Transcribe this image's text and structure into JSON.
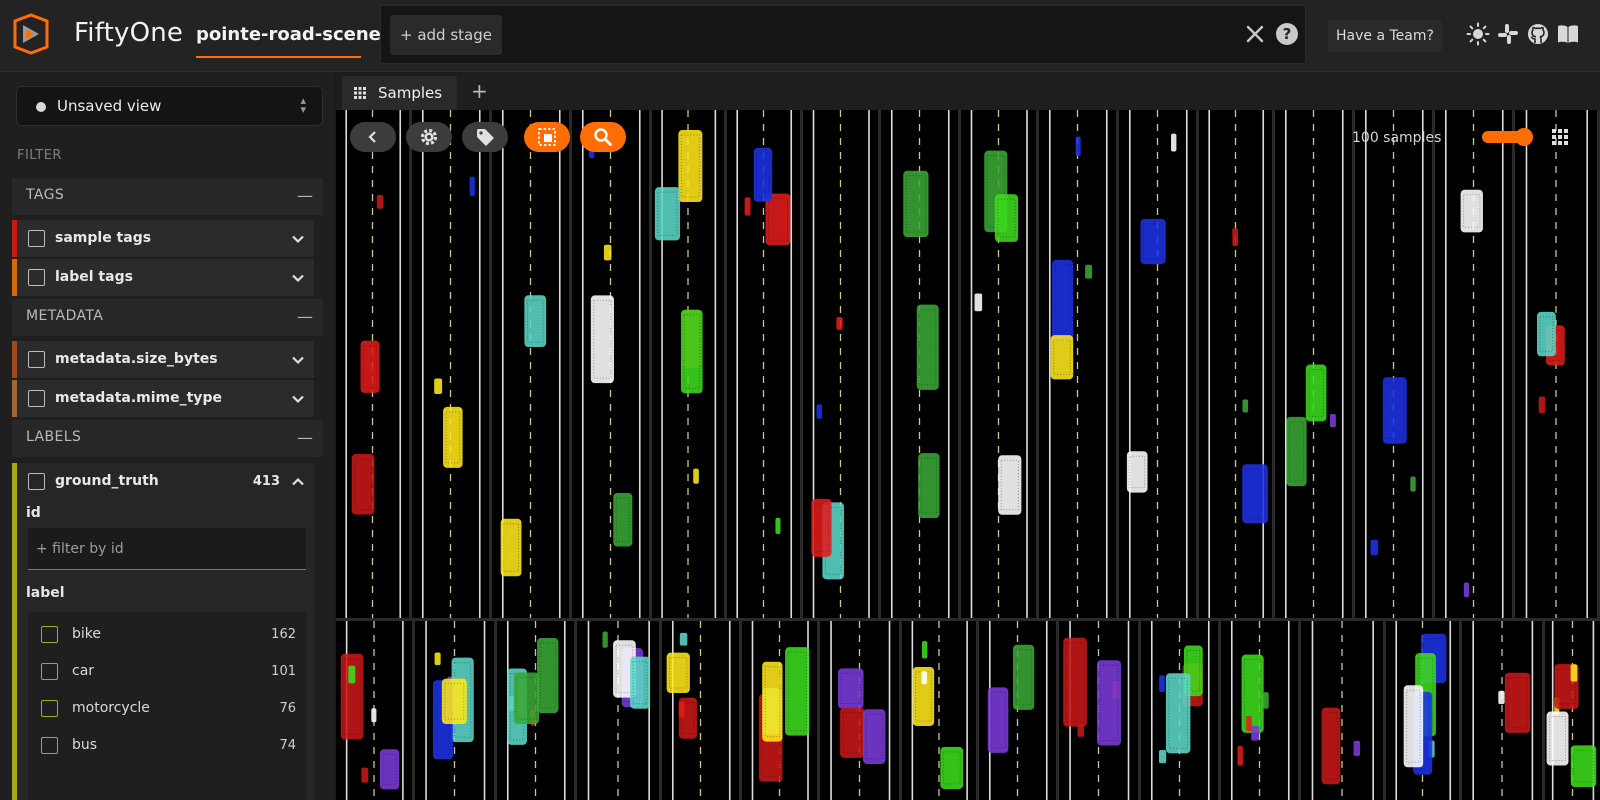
{
  "header": {
    "app_title": "FiftyOne",
    "dataset_name": "pointe-road-scenes",
    "add_stage_label": "+ add stage",
    "team_button_label": "Have a Team?",
    "icons": [
      "brightness-icon",
      "slack-icon",
      "github-icon",
      "book-icon"
    ]
  },
  "sidebar": {
    "view_select_label": "Unsaved view",
    "filter_title": "FILTER",
    "groups": {
      "tags": "TAGS",
      "metadata": "METADATA",
      "labels": "LABELS"
    },
    "fields": {
      "sample_tags": "sample tags",
      "label_tags": "label tags",
      "size_bytes": "metadata.size_bytes",
      "mime_type": "metadata.mime_type",
      "ground_truth": "ground_truth",
      "ground_truth_count": "413"
    },
    "ground_truth_panel": {
      "id_label": "id",
      "id_placeholder": "+ filter by id",
      "label_label": "label",
      "labels": [
        {
          "name": "bike",
          "count": "162"
        },
        {
          "name": "car",
          "count": "101"
        },
        {
          "name": "motorcycle",
          "count": "76"
        },
        {
          "name": "bus",
          "count": "74"
        }
      ]
    },
    "colors": {
      "sample_tags": "#c8181a",
      "label_tags": "#d66a0f",
      "size_bytes": "#9b4a1e",
      "mime_type": "#a2643a",
      "ground_truth": "#a8a81c"
    }
  },
  "main": {
    "tab_label": "Samples",
    "sample_count": "100 samples",
    "accent_color": "#ff6d04"
  }
}
